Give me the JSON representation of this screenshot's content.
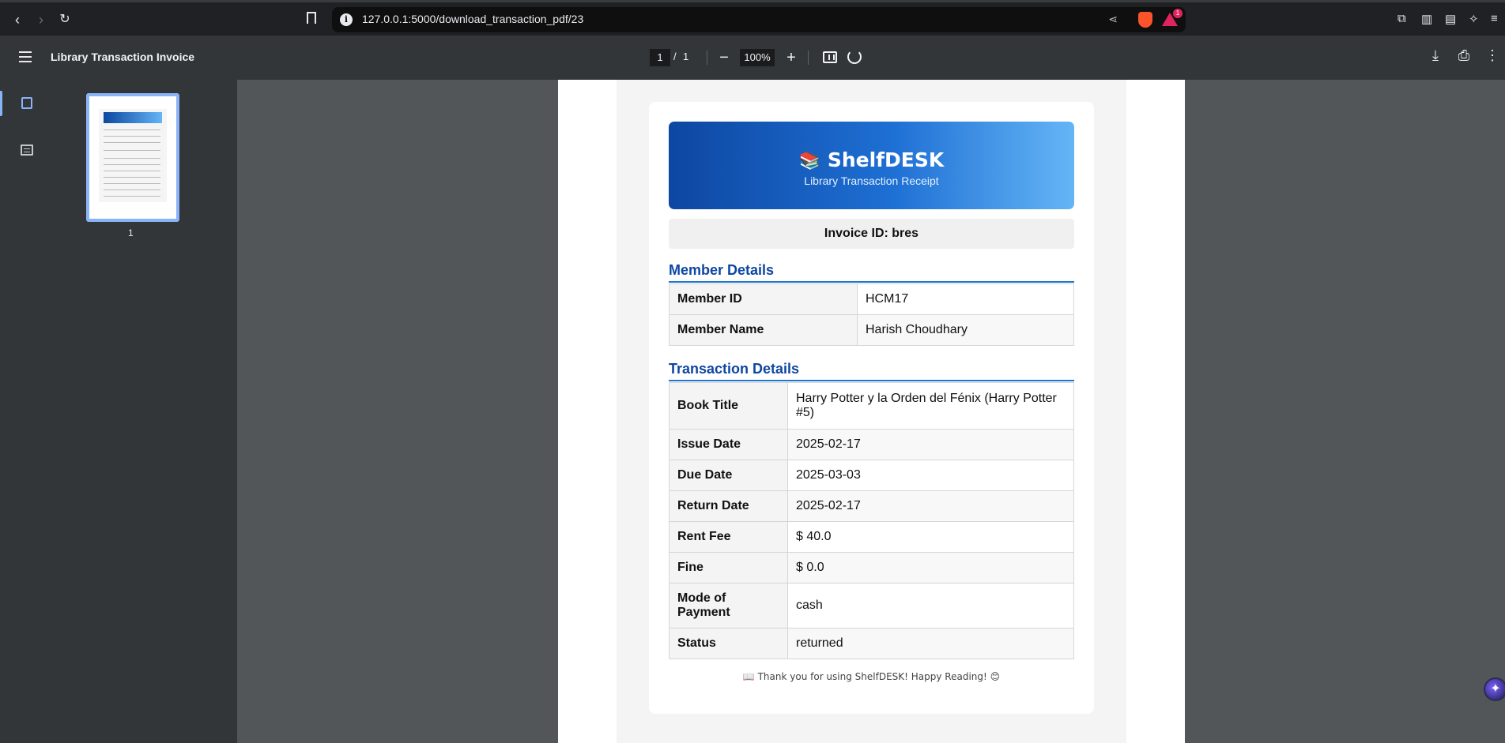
{
  "browser": {
    "url": "127.0.0.1:5000/download_transaction_pdf/23",
    "back_icon": "chevron-left-icon",
    "forward_icon": "chevron-right-icon",
    "reload_icon": "reload-icon",
    "rewards_badge": "1"
  },
  "toolbar": {
    "title": "Library Transaction Invoice",
    "page_current": "1",
    "page_separator": "/",
    "page_total": "1",
    "zoom": "100%"
  },
  "sidebar": {
    "thumbnail_label": "1"
  },
  "receipt": {
    "brand": "ShelfDESK",
    "brand_emoji": "📚",
    "subtitle": "Library Transaction Receipt",
    "invoice_id": "Invoice ID: bres",
    "member_section": "Member Details",
    "member_rows": [
      {
        "key": "Member ID",
        "value": "HCM17"
      },
      {
        "key": "Member Name",
        "value": "Harish Choudhary"
      }
    ],
    "transaction_section": "Transaction Details",
    "transaction_rows": [
      {
        "key": "Book Title",
        "value": "Harry Potter y la Orden del Fénix (Harry Potter #5)"
      },
      {
        "key": "Issue Date",
        "value": "2025-02-17"
      },
      {
        "key": "Due Date",
        "value": "2025-03-03"
      },
      {
        "key": "Return Date",
        "value": "2025-02-17"
      },
      {
        "key": "Rent Fee",
        "value": "$ 40.0"
      },
      {
        "key": "Fine",
        "value": "$ 0.0"
      },
      {
        "key": "Mode of Payment",
        "value": "cash"
      },
      {
        "key": "Status",
        "value": "returned"
      }
    ],
    "footer": "📖 Thank you for using ShelfDESK! Happy Reading! 😊"
  },
  "colors": {
    "header_start": "#0d47a1",
    "header_end": "#64b5f6",
    "section_title": "#0d47a1",
    "toolbar_bg": "#323639",
    "viewer_bg": "#525659"
  }
}
